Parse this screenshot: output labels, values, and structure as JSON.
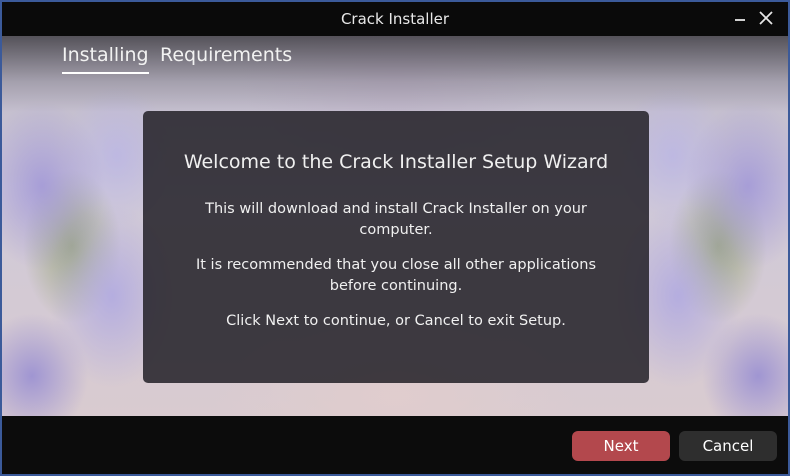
{
  "window": {
    "title": "Crack Installer"
  },
  "controls": {
    "minimize_icon": "minimize-icon",
    "close_icon": "close-icon"
  },
  "tabs": [
    {
      "label": "Installing",
      "active": true
    },
    {
      "label": "Requirements",
      "active": false
    }
  ],
  "dialog": {
    "heading": "Welcome to the Crack Installer Setup Wizard",
    "line1": "This will download and install Crack Installer on your computer.",
    "line2": "It is recommended that you close all other applications before continuing.",
    "line3": "Click Next to continue, or Cancel to exit Setup."
  },
  "footer": {
    "next_label": "Next",
    "cancel_label": "Cancel"
  },
  "colors": {
    "accent": "#b3484d",
    "window_border": "#3b5a9a"
  }
}
